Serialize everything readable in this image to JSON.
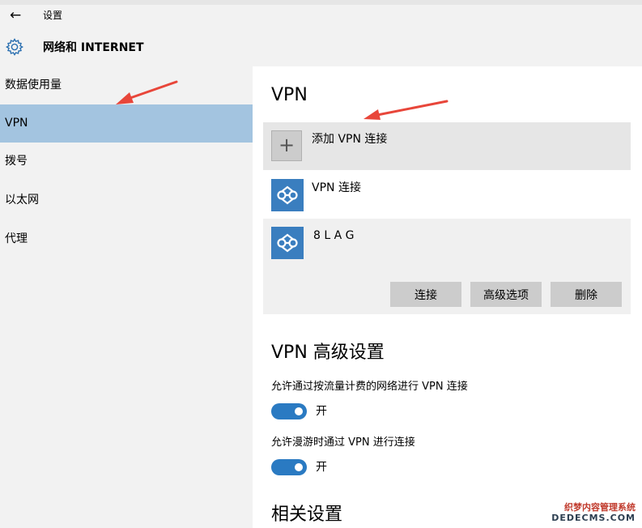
{
  "window": {
    "title": "设置",
    "back_icon": "back-arrow-icon"
  },
  "header": {
    "icon": "gear-icon",
    "title": "网络和 INTERNET"
  },
  "sidebar": {
    "items": [
      {
        "label": "数据使用量",
        "selected": false
      },
      {
        "label": "VPN",
        "selected": true
      },
      {
        "label": "拨号",
        "selected": false
      },
      {
        "label": "以太网",
        "selected": false
      },
      {
        "label": "代理",
        "selected": false
      }
    ]
  },
  "main": {
    "vpn_title": "VPN",
    "add_vpn": {
      "icon": "plus-icon",
      "label": "添加 VPN 连接"
    },
    "connections": [
      {
        "icon": "vpn-icon",
        "name": "VPN 连接"
      },
      {
        "icon": "vpn-icon",
        "name": "8 L A G",
        "expanded": true
      }
    ],
    "actions": {
      "connect": "连接",
      "advanced": "高级选项",
      "delete": "删除"
    },
    "advanced_title": "VPN 高级设置",
    "settings": [
      {
        "label": "允许通过按流量计费的网络进行 VPN 连接",
        "state": "开",
        "on": true
      },
      {
        "label": "允许漫游时通过 VPN 进行连接",
        "state": "开",
        "on": true
      }
    ],
    "related_title": "相关设置"
  },
  "watermark": {
    "line1": "织梦内容管理系统",
    "line2": "DEDECMS.COM"
  },
  "colors": {
    "sidebar_selected": "#a3c4e0",
    "accent": "#2a7ac2",
    "vpn_icon": "#3a7ebf",
    "arrow": "#e8463a"
  }
}
